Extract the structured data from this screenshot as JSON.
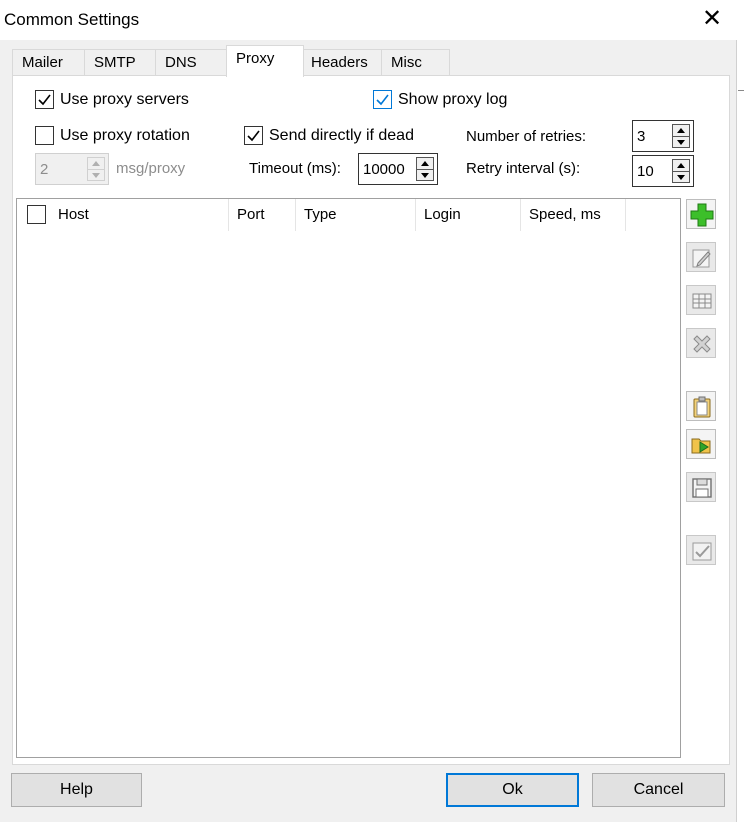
{
  "window": {
    "title": "Common Settings"
  },
  "tabs": [
    {
      "label": "Mailer"
    },
    {
      "label": "SMTP"
    },
    {
      "label": "DNS"
    },
    {
      "label": "Proxy",
      "active": true
    },
    {
      "label": "Headers"
    },
    {
      "label": "Misc"
    }
  ],
  "options": {
    "use_proxy_servers": {
      "label": "Use proxy servers",
      "checked": true
    },
    "show_proxy_log": {
      "label": "Show proxy log",
      "checked": true
    },
    "use_proxy_rotation": {
      "label": "Use proxy rotation",
      "checked": false
    },
    "send_directly_if_dead": {
      "label": "Send directly if dead",
      "checked": true
    },
    "msg_per_proxy": {
      "value": "2",
      "unit_label": "msg/proxy",
      "enabled": false
    },
    "timeout": {
      "label": "Timeout (ms):",
      "value": "10000"
    },
    "number_of_retries": {
      "label": "Number of retries:",
      "value": "3"
    },
    "retry_interval": {
      "label": "Retry interval (s):",
      "value": "10"
    }
  },
  "table": {
    "columns": [
      "Host",
      "Port",
      "Type",
      "Login",
      "Speed, ms"
    ],
    "rows": []
  },
  "toolbar": [
    {
      "name": "add-proxy",
      "icon": "green-plus-icon"
    },
    {
      "name": "edit-proxy",
      "icon": "edit-pencil-icon"
    },
    {
      "name": "proxy-list",
      "icon": "table-grid-icon"
    },
    {
      "name": "delete-proxy",
      "icon": "delete-x-icon"
    },
    {
      "name": "paste-proxies",
      "icon": "clipboard-icon"
    },
    {
      "name": "import-proxies",
      "icon": "open-folder-icon"
    },
    {
      "name": "save-proxies",
      "icon": "floppy-disk-icon"
    },
    {
      "name": "check-proxies",
      "icon": "checkmark-icon"
    }
  ],
  "footer": {
    "help_label": "Help",
    "ok_label": "Ok",
    "cancel_label": "Cancel"
  },
  "colors": {
    "accent": "#0078d7",
    "add_green": "#3cbf2a",
    "dialog_bg": "#f0f0f0"
  }
}
